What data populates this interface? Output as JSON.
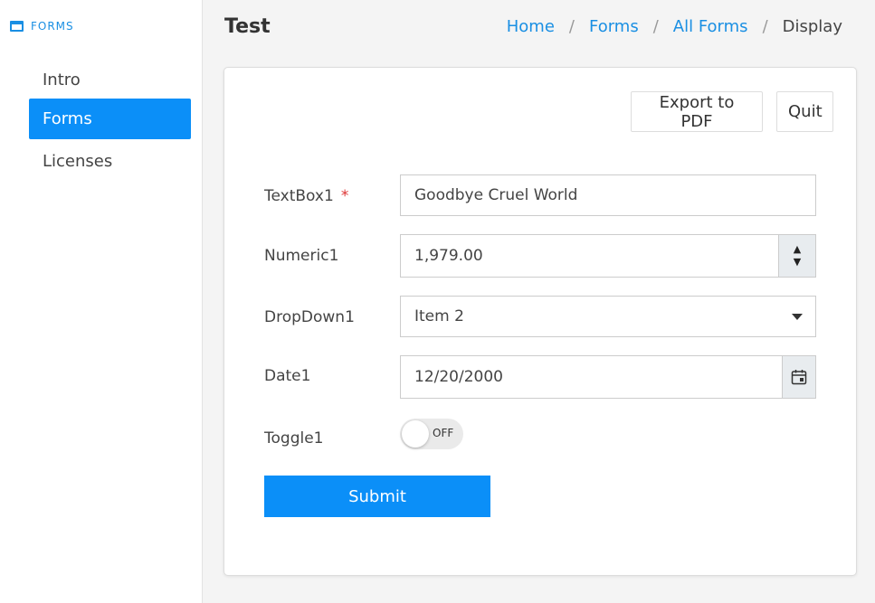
{
  "sidebar": {
    "header": "FORMS",
    "items": [
      {
        "label": "Intro"
      },
      {
        "label": "Forms"
      },
      {
        "label": "Licenses"
      }
    ]
  },
  "header": {
    "title": "Test",
    "breadcrumb": {
      "home": "Home",
      "forms": "Forms",
      "all_forms": "All Forms",
      "current": "Display",
      "separator": "/"
    }
  },
  "toolbar": {
    "export_label": "Export to PDF",
    "quit_label": "Quit"
  },
  "form": {
    "textbox": {
      "label": "TextBox1",
      "required_mark": "*",
      "value": "Goodbye Cruel World"
    },
    "numeric": {
      "label": "Numeric1",
      "value": "1,979.00",
      "up": "▲",
      "down": "▼"
    },
    "dropdown": {
      "label": "DropDown1",
      "value": "Item 2"
    },
    "date": {
      "label": "Date1",
      "value": "12/20/2000"
    },
    "toggle": {
      "label": "Toggle1",
      "state": "OFF"
    },
    "submit_label": "Submit"
  },
  "colors": {
    "accent": "#0b8ff8",
    "link": "#1a8fe3",
    "required": "#dd3333"
  }
}
